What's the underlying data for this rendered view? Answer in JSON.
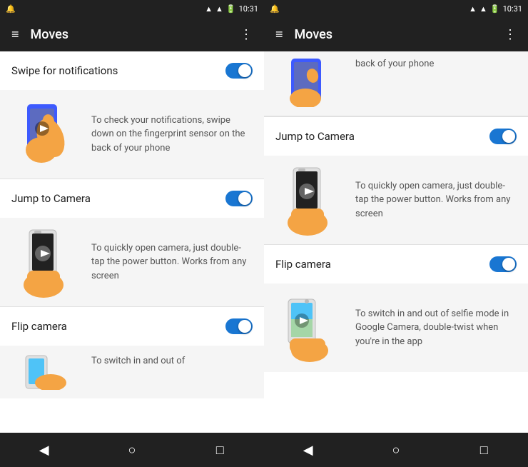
{
  "left_phone": {
    "status_bar": {
      "time": "10:31",
      "signal": "▲▼",
      "battery": "■"
    },
    "app_bar": {
      "title": "Moves",
      "hamburger": "≡",
      "more": "⋮"
    },
    "settings": [
      {
        "id": "swipe-notifications",
        "label": "Swipe for notifications",
        "enabled": true,
        "demo_text": "To check your notifications, swipe down on the fingerprint sensor on the back of your phone"
      },
      {
        "id": "jump-to-camera",
        "label": "Jump to Camera",
        "enabled": true,
        "demo_text": "To quickly open camera, just double-tap the power button. Works from any screen"
      },
      {
        "id": "flip-camera",
        "label": "Flip camera",
        "enabled": true,
        "demo_text": "To switch in and out of"
      }
    ],
    "nav": {
      "back": "◀",
      "home": "○",
      "recent": "□"
    }
  },
  "right_phone": {
    "status_bar": {
      "time": "10:31"
    },
    "app_bar": {
      "title": "Moves",
      "hamburger": "≡",
      "more": "⋮"
    },
    "partial_top_text": "back of your phone",
    "settings": [
      {
        "id": "jump-to-camera",
        "label": "Jump to Camera",
        "enabled": true,
        "demo_text": "To quickly open camera, just double-tap the power button. Works from any screen"
      },
      {
        "id": "flip-camera",
        "label": "Flip camera",
        "enabled": true,
        "demo_text": "To switch in and out of selfie mode in Google Camera, double-twist when you're in the app"
      }
    ],
    "nav": {
      "back": "◀",
      "home": "○",
      "recent": "□"
    }
  }
}
